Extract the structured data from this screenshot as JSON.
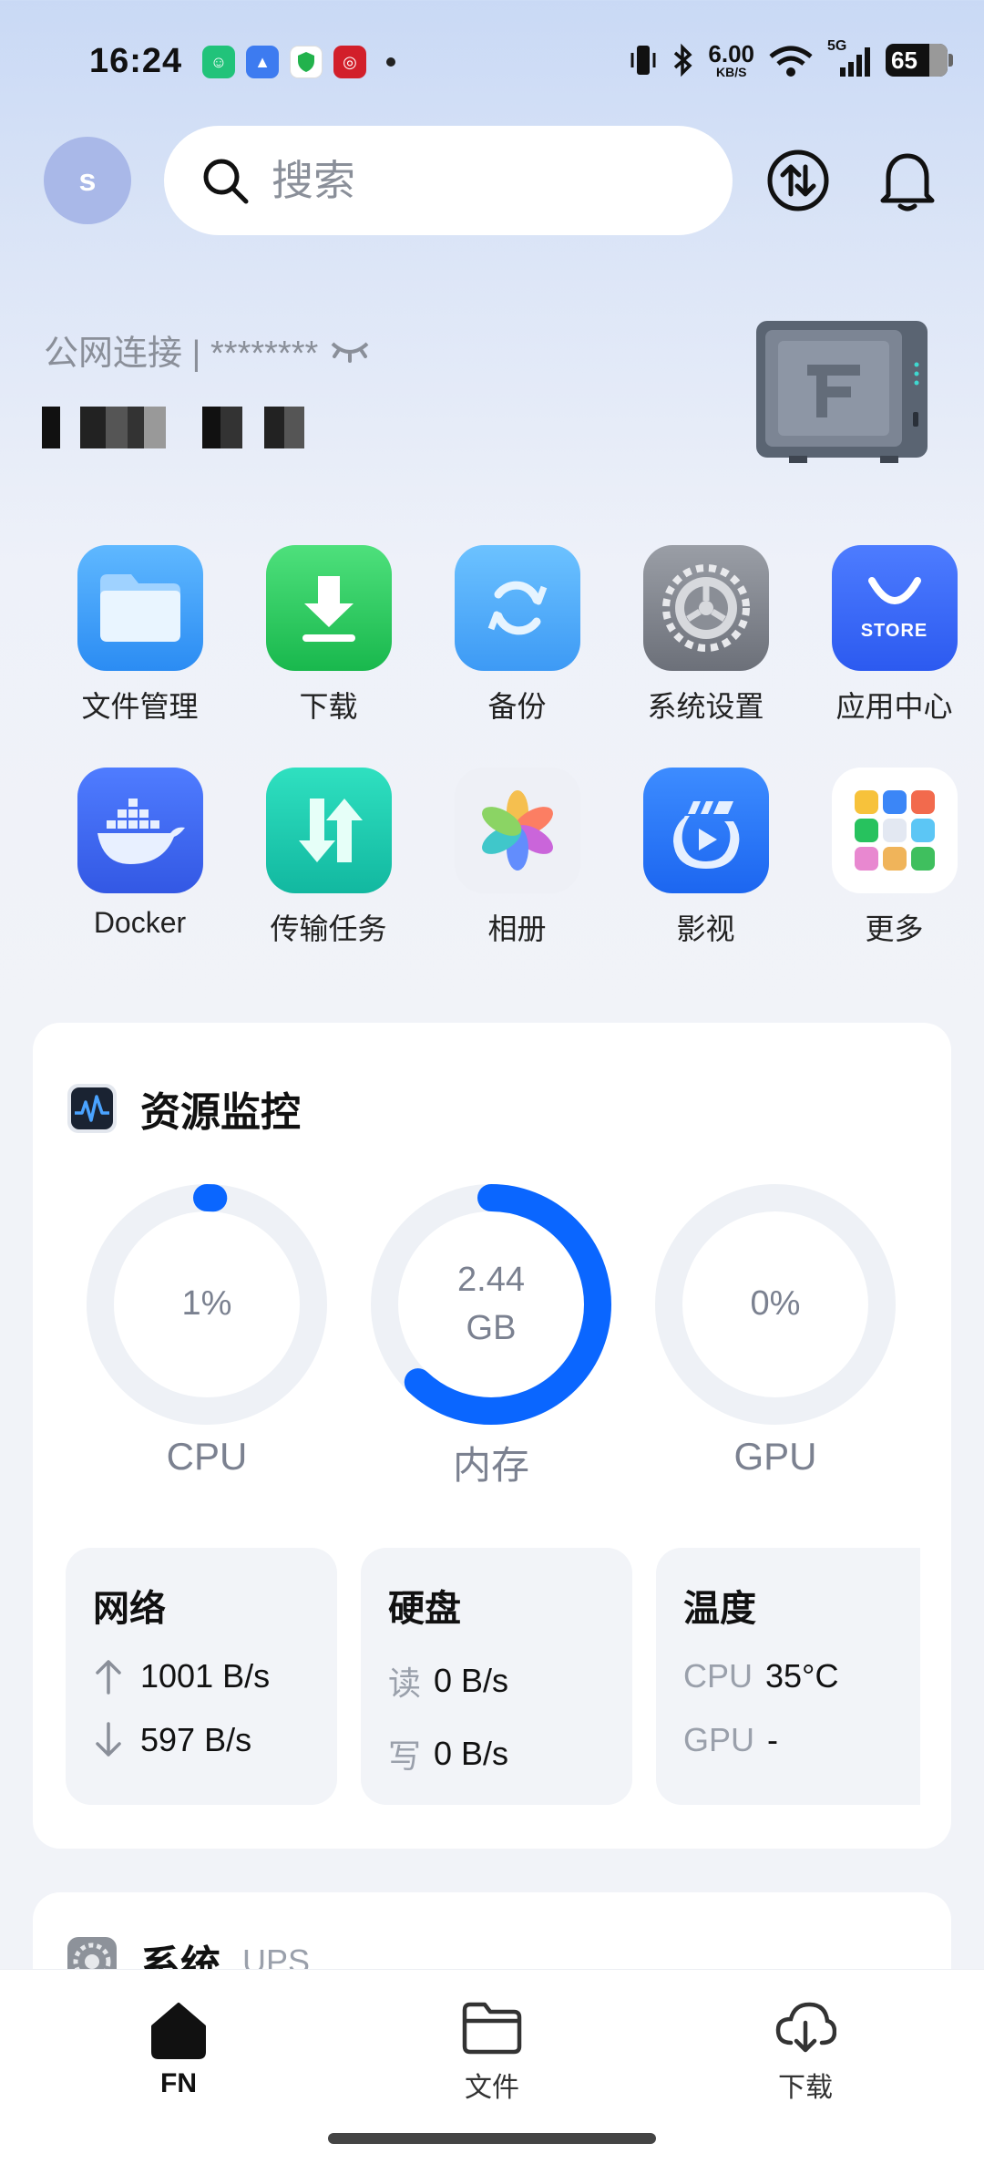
{
  "status_bar": {
    "time": "16:24",
    "speed_value": "6.00",
    "speed_unit": "KB/S",
    "network": "5G",
    "battery": "65"
  },
  "header": {
    "avatar_initial": "s",
    "search_placeholder": "搜索"
  },
  "connection": {
    "label": "公网连接 | ********"
  },
  "apps": [
    {
      "label": "文件管理",
      "icon": "folder-icon"
    },
    {
      "label": "下载",
      "icon": "download-icon"
    },
    {
      "label": "备份",
      "icon": "backup-icon"
    },
    {
      "label": "系统设置",
      "icon": "settings-gear-icon"
    },
    {
      "label": "应用中心",
      "icon": "app-store-icon",
      "badge": "STORE"
    },
    {
      "label": "Docker",
      "icon": "docker-whale-icon"
    },
    {
      "label": "传输任务",
      "icon": "transfer-icon"
    },
    {
      "label": "相册",
      "icon": "photos-flower-icon"
    },
    {
      "label": "影视",
      "icon": "video-play-icon"
    },
    {
      "label": "更多",
      "icon": "more-grid-icon"
    }
  ],
  "resource_monitor": {
    "title": "资源监控",
    "cpu": {
      "value": "1%",
      "label": "CPU",
      "fraction": 0.01
    },
    "memory": {
      "value": "2.44",
      "unit": "GB",
      "label": "内存",
      "fraction": 0.62
    },
    "gpu": {
      "value": "0%",
      "label": "GPU",
      "fraction": 0
    },
    "network": {
      "title": "网络",
      "up": "1001 B/s",
      "down": "597 B/s"
    },
    "disk": {
      "title": "硬盘",
      "read_label": "读",
      "read": "0 B/s",
      "write_label": "写",
      "write": "0 B/s"
    },
    "temperature": {
      "title": "温度",
      "cpu_label": "CPU",
      "cpu": "35°C",
      "gpu_label": "GPU",
      "gpu": "-"
    }
  },
  "system_card": {
    "title": "系统",
    "subtitle": "UPS"
  },
  "bottom_nav": [
    {
      "label": "FN",
      "active": true
    },
    {
      "label": "文件",
      "active": false
    },
    {
      "label": "下载",
      "active": false
    }
  ],
  "colors": {
    "accent": "#0a66ff",
    "ring_track": "#eef1f6"
  }
}
